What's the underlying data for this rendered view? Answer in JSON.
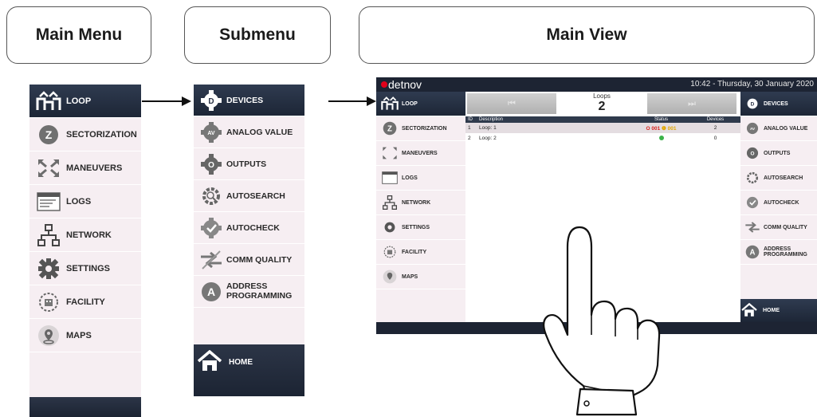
{
  "panels": {
    "main_menu_title": "Main Menu",
    "submenu_title": "Submenu",
    "main_view_title": "Main View"
  },
  "main_menu": {
    "items": [
      {
        "label": "LOOP",
        "icon": "loop-icon",
        "active": true
      },
      {
        "label": "SECTORIZATION",
        "icon": "sectorization-icon"
      },
      {
        "label": "MANEUVERS",
        "icon": "maneuvers-icon"
      },
      {
        "label": "LOGS",
        "icon": "logs-icon"
      },
      {
        "label": "NETWORK",
        "icon": "network-icon"
      },
      {
        "label": "SETTINGS",
        "icon": "gear-icon"
      },
      {
        "label": "FACILITY",
        "icon": "facility-icon"
      },
      {
        "label": "MAPS",
        "icon": "map-pin-icon"
      }
    ]
  },
  "submenu": {
    "items": [
      {
        "label": "DEVICES",
        "icon": "devices-icon",
        "active": true
      },
      {
        "label": "ANALOG VALUE",
        "icon": "analog-value-icon"
      },
      {
        "label": "OUTPUTS",
        "icon": "outputs-icon"
      },
      {
        "label": "AUTOSEARCH",
        "icon": "autosearch-icon"
      },
      {
        "label": "AUTOCHECK",
        "icon": "autocheck-icon"
      },
      {
        "label": "COMM QUALITY",
        "icon": "comm-quality-icon"
      },
      {
        "label": "ADDRESS PROGRAMMING",
        "icon": "address-programming-icon"
      }
    ],
    "home_label": "HOME"
  },
  "main_view": {
    "brand": "detnov",
    "clock": "10:42  -  Thursday, 30 January 2020",
    "loops_title": "Loops",
    "loops_count": "2",
    "prev_symbol": "⏮",
    "next_symbol": "⏭",
    "table": {
      "headers": [
        "ID",
        "Description",
        "Status",
        "Devices"
      ],
      "rows": [
        {
          "id": "1",
          "description": "Loop: 1",
          "status_red": "001",
          "status_yellow": "001",
          "devices": "2"
        },
        {
          "id": "2",
          "description": "Loop: 2",
          "status": "ok",
          "devices": "0"
        }
      ]
    }
  },
  "colors": {
    "nav_dark": "#1d2433",
    "menu_bg": "#f6eef2",
    "brand_red": "#e2001a",
    "status_red": "#d9231d",
    "status_yellow": "#e2a700",
    "status_green": "#3cb34a"
  }
}
